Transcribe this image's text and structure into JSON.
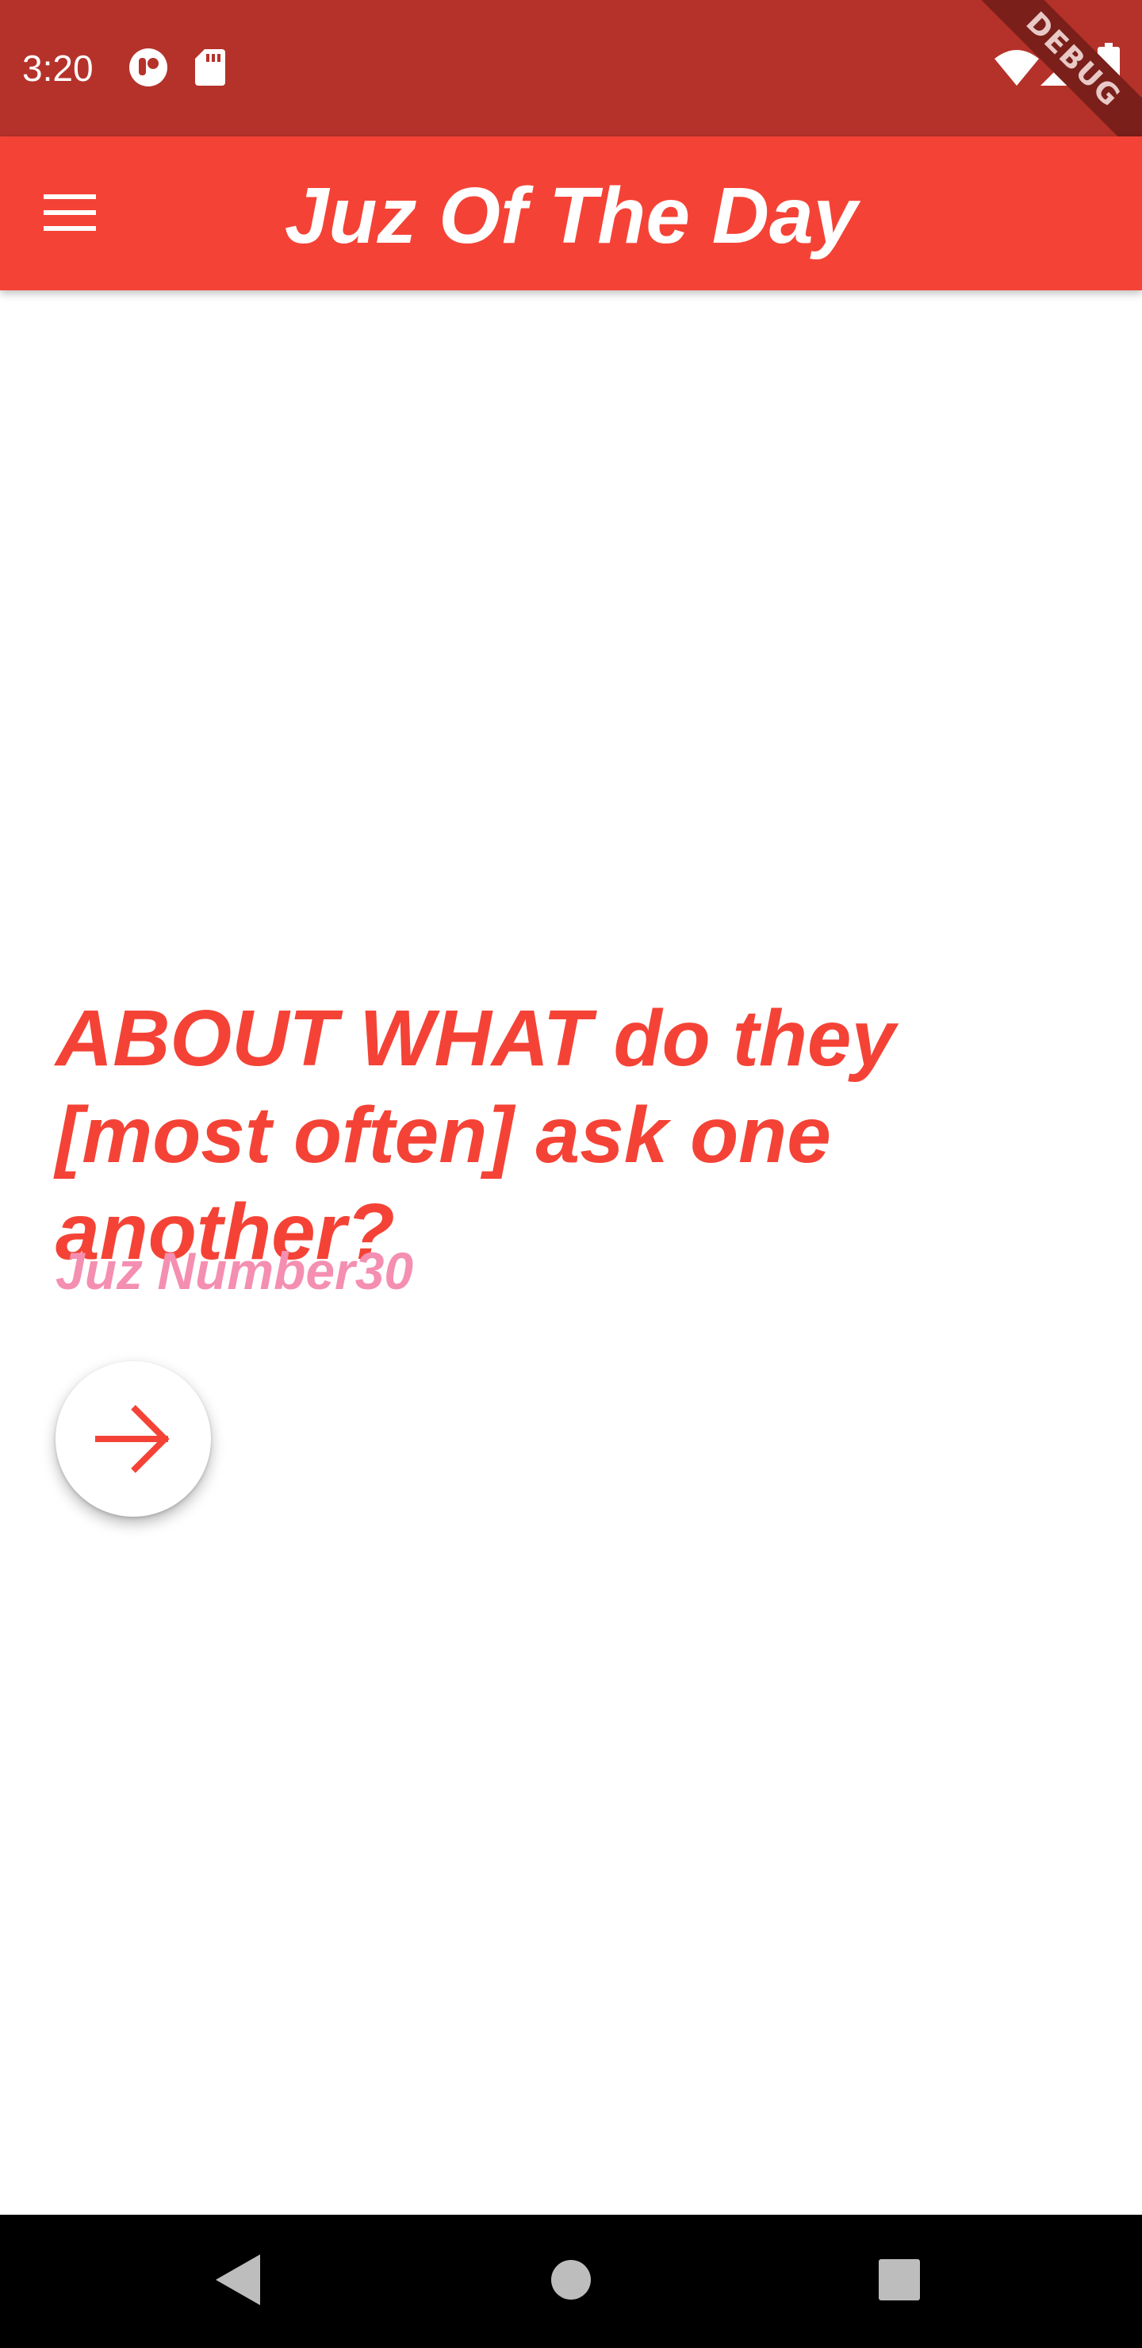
{
  "status_bar": {
    "time": "3:20",
    "icons": [
      "app-notification-icon",
      "sd-card-icon",
      "wifi-icon",
      "signal-icon",
      "battery-icon"
    ],
    "background": "#b5322a"
  },
  "debug_banner": {
    "label": "DEBUG"
  },
  "app_bar": {
    "title": "Juz Of The Day",
    "menu_icon": "hamburger-menu-icon",
    "background": "#f44336"
  },
  "content": {
    "quote": "ABOUT WHAT do they [most often] ask one another?",
    "juz_label": "Juz Number30",
    "next_icon": "arrow-forward-icon"
  },
  "colors": {
    "accent": "#f44336",
    "secondary": "#f48fb1",
    "status_bar": "#b5322a"
  },
  "nav_bar": {
    "buttons": [
      "back-icon",
      "home-icon",
      "recents-icon"
    ]
  }
}
